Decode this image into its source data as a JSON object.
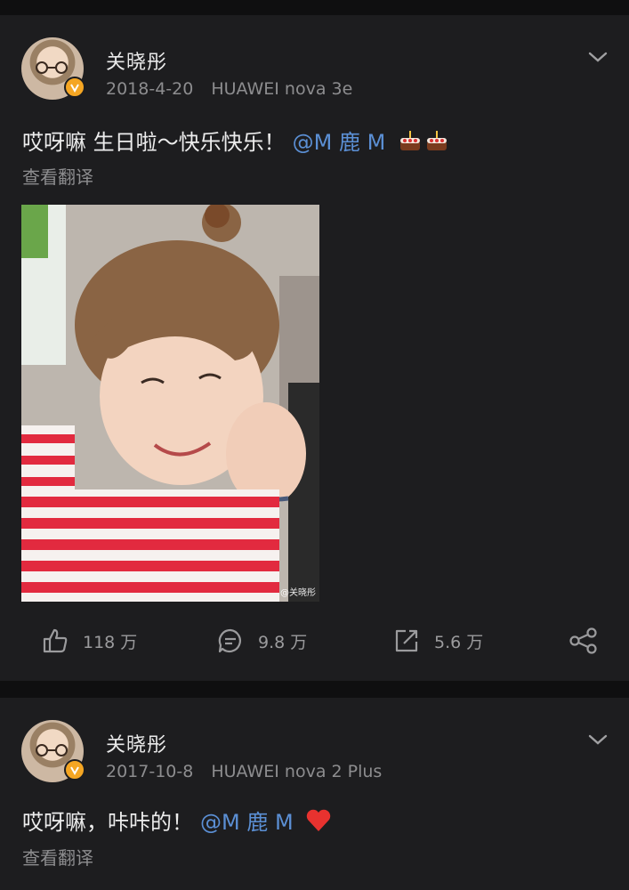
{
  "posts": [
    {
      "user": "关晓彤",
      "date": "2018-4-20",
      "device": "HUAWEI nova 3e",
      "text": "哎呀嘛 生日啦～快乐快乐！",
      "mention": "@M 鹿 M",
      "emojis": [
        "cake-emoji",
        "cake-emoji"
      ],
      "translate": "查看翻译",
      "image_watermark": "@关晓彤",
      "actions": {
        "likes": "118 万",
        "comments": "9.8 万",
        "reposts": "5.6 万"
      }
    },
    {
      "user": "关晓彤",
      "date": "2017-10-8",
      "device": "HUAWEI nova 2 Plus",
      "text": "哎呀嘛，咔咔的！",
      "mention": "@M 鹿 M",
      "emojis": [
        "heart-emoji"
      ],
      "translate": "查看翻译"
    }
  ],
  "colors": {
    "background": "#0f0f10",
    "card": "#1d1d1f",
    "mention": "#5b8fd4",
    "verified_badge": "#f5a623",
    "muted_text": "#8d8d8f"
  }
}
